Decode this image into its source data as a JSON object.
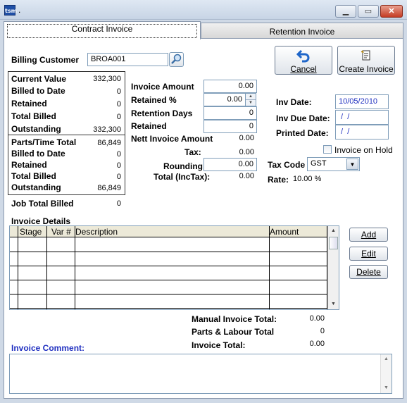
{
  "window": {
    "title": ".",
    "logo": "tsm"
  },
  "tabs": {
    "contract": "Contract Invoice",
    "retention": "Retention Invoice"
  },
  "billing": {
    "label": "Billing Customer",
    "value": "BROA001"
  },
  "buttons": {
    "cancel": "Cancel",
    "create": "Create Invoice",
    "add": "Add",
    "edit": "Edit",
    "delete": "Delete"
  },
  "contract_summary": [
    {
      "label": "Current Value",
      "value": "332,300"
    },
    {
      "label": "Billed to Date",
      "value": "0"
    },
    {
      "label": "Retained",
      "value": "0"
    },
    {
      "label": "Total Billed",
      "value": "0"
    },
    {
      "label": "Outstanding",
      "value": "332,300"
    }
  ],
  "parts_summary": [
    {
      "label": "Parts/Time Total",
      "value": "86,849"
    },
    {
      "label": "Billed to Date",
      "value": "0"
    },
    {
      "label": "Retained",
      "value": "0"
    },
    {
      "label": "Total Billed",
      "value": "0"
    },
    {
      "label": "Outstanding",
      "value": "86,849"
    }
  ],
  "job_total": {
    "label": "Job Total Billed",
    "value": "0"
  },
  "invoice_calc": {
    "amount_label": "Invoice Amount",
    "amount": "0.00",
    "retained_pct_label": "Retained %",
    "retained_pct": "0.00",
    "retention_days_label": "Retention Days",
    "retention_days": "0",
    "retained_label": "Retained",
    "retained": "0",
    "nett_label": "Nett Invoice Amount",
    "nett": "0.00",
    "tax_label": "Tax:",
    "tax": "0.00",
    "rounding_label": "Rounding",
    "rounding": "0.00",
    "total_label": "Total (IncTax):",
    "total": "0.00"
  },
  "dates": {
    "inv_date_label": "Inv Date:",
    "inv_date": "10/05/2010",
    "due_date_label": "Inv Due Date:",
    "due_date": " /  /",
    "printed_label": "Printed Date:",
    "printed": " /  /"
  },
  "hold": {
    "label": "Invoice on Hold",
    "checked": false
  },
  "tax": {
    "code_label": "Tax Code",
    "code": "GST",
    "rate_label": "Rate:",
    "rate": "10.00 %"
  },
  "details": {
    "title": "Invoice Details",
    "columns": [
      "Stage",
      "Var #",
      "Description",
      "Amount"
    ]
  },
  "totals": [
    {
      "label": "Manual Invoice Total:",
      "value": "0.00"
    },
    {
      "label": "Parts & Labour Total",
      "value": "0"
    },
    {
      "label": "Invoice Total:",
      "value": "0.00"
    }
  ],
  "comment": {
    "label": "Invoice Comment:",
    "value": ""
  },
  "colors": {
    "accent": "#1f2fc0",
    "date_text": "#1f2fc0",
    "icon_blue": "#1f66c9"
  }
}
